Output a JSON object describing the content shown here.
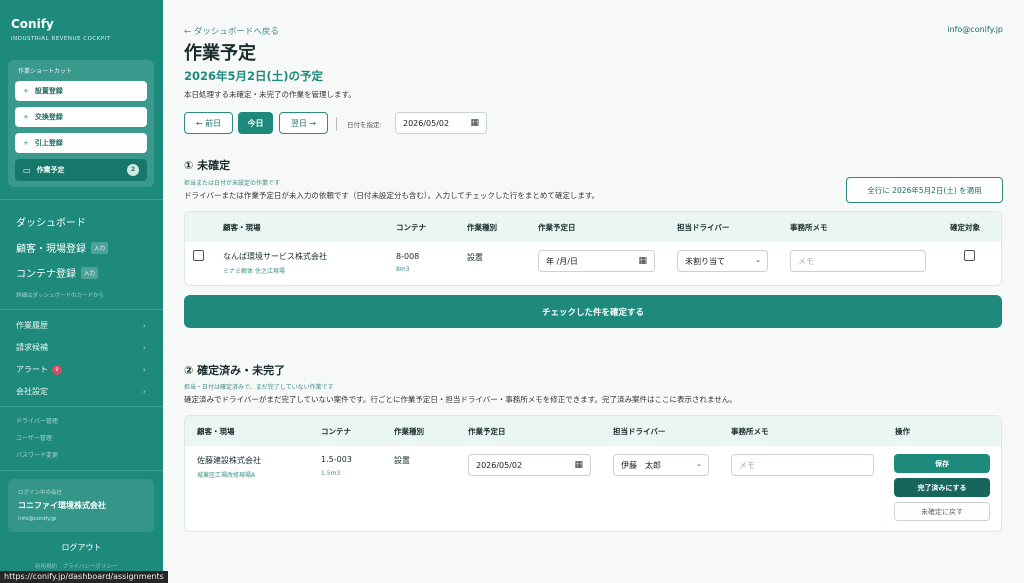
{
  "sidebar": {
    "brand": "Conify",
    "brand_sub": "INDUSTRIAL REVENUE COCKPIT",
    "shortcut_title": "作業ショートカット",
    "shortcuts": [
      {
        "label": "設置登録"
      },
      {
        "label": "交換登録"
      },
      {
        "label": "引上登録"
      }
    ],
    "active_shortcut": {
      "label": "作業予定",
      "badge": "2"
    },
    "nav_main": [
      {
        "label": "ダッシュボード",
        "tag": ""
      },
      {
        "label": "顧客・現場登録",
        "tag": "入力"
      },
      {
        "label": "コンテナ登録",
        "tag": "入力"
      }
    ],
    "hint": "詳細はダッシュボードのカードから",
    "nav_mid": [
      {
        "label": "作業履歴"
      },
      {
        "label": "請求候補"
      },
      {
        "label": "アラート",
        "badge": "9"
      },
      {
        "label": "会社設定"
      }
    ],
    "nav_small": [
      {
        "label": "ドライバー管理"
      },
      {
        "label": "ユーザー管理"
      },
      {
        "label": "パスワード変更"
      }
    ],
    "login": {
      "label": "ログイン中の会社",
      "company": "コニファイ環境株式会社",
      "email": "info@conify.jp"
    },
    "logout": "ログアウト",
    "footer": "利用規約　プライバシーポリシー"
  },
  "status_bar": "https://conify.jp/dashboard/assignments",
  "header": {
    "back": "← ダッシュボードへ戻る",
    "user_email": "info@conify.jp",
    "title": "作業予定",
    "subtitle": "2026年5月2日(土)の予定",
    "description": "本日処理する未確定・未完了の作業を管理します。"
  },
  "date_nav": {
    "prev": "← 前日",
    "today": "今日",
    "next": "翌日 →",
    "date_label": "日付を指定:",
    "date_value": "2026/05/02"
  },
  "unconfirmed": {
    "title": "① 未確定",
    "note": "担当または日付が未設定の作業です",
    "description": "ドライバーまたは作業予定日が未入力の依頼です（日付未設定分も含む）。入力してチェックした行をまとめて確定します。",
    "apply_all": "全行に 2026年5月2日(土) を適用",
    "columns": [
      "顧客・現場",
      "コンテナ",
      "作業種別",
      "作業予定日",
      "担当ドライバー",
      "事務所メモ",
      "確定対象"
    ],
    "rows": [
      {
        "customer": "なんば環境サービス株式会社",
        "site": "ミナミ解体 住之江現場",
        "container": "8-008",
        "size": "8m3",
        "work_type": "設置",
        "date_placeholder": "年 /月/日",
        "driver": "未割り当て",
        "memo_placeholder": "メモ"
      }
    ],
    "confirm_button": "チェックした件を確定する"
  },
  "confirmed": {
    "title": "② 確定済み・未完了",
    "note": "担当・日付は確定済みで、まだ完了していない作業です",
    "description": "確定済みでドライバーがまだ完了していない案件です。行ごとに作業予定日・担当ドライバー・事務所メモを修正できます。完了済み案件はここに表示されません。",
    "columns": [
      "顧客・現場",
      "コンテナ",
      "作業種別",
      "作業予定日",
      "担当ドライバー",
      "事務所メモ",
      "操作"
    ],
    "rows": [
      {
        "customer": "佐藤建設株式会社",
        "site": "城東区工場改修現場A",
        "container": "1.5-003",
        "size": "1.5m3",
        "work_type": "設置",
        "date_value": "2026/05/02",
        "driver": "伊藤　太郎",
        "memo_placeholder": "メモ",
        "actions": {
          "save": "保存",
          "complete": "完了済みにする",
          "revert": "未確定に戻す"
        }
      }
    ]
  },
  "colors": {
    "primary": "#1d8a7c",
    "dark": "#17665c",
    "alert": "#e24a62"
  }
}
